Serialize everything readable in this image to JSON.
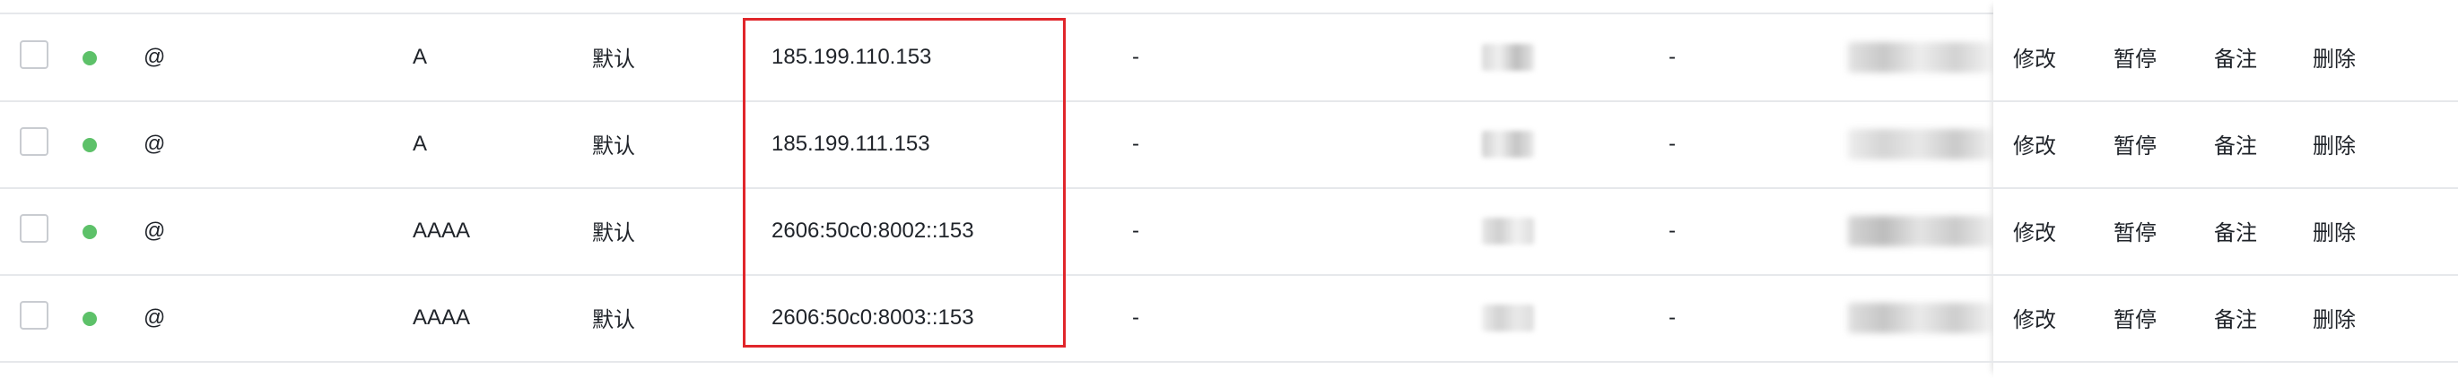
{
  "records": [
    {
      "host": "@",
      "type": "A",
      "line": "默认",
      "value": "185.199.110.153",
      "mx": "-",
      "weight": "-"
    },
    {
      "host": "@",
      "type": "A",
      "line": "默认",
      "value": "185.199.111.153",
      "mx": "-",
      "weight": "-"
    },
    {
      "host": "@",
      "type": "AAAA",
      "line": "默认",
      "value": "2606:50c0:8002::153",
      "mx": "-",
      "weight": "-"
    },
    {
      "host": "@",
      "type": "AAAA",
      "line": "默认",
      "value": "2606:50c0:8003::153",
      "mx": "-",
      "weight": "-"
    }
  ],
  "actions": {
    "edit": "修改",
    "pause": "暂停",
    "note": "备注",
    "delete": "删除"
  },
  "colors": {
    "accent": "#1e6fd9",
    "status_enabled": "#5dc169",
    "highlight": "#e0262b"
  }
}
